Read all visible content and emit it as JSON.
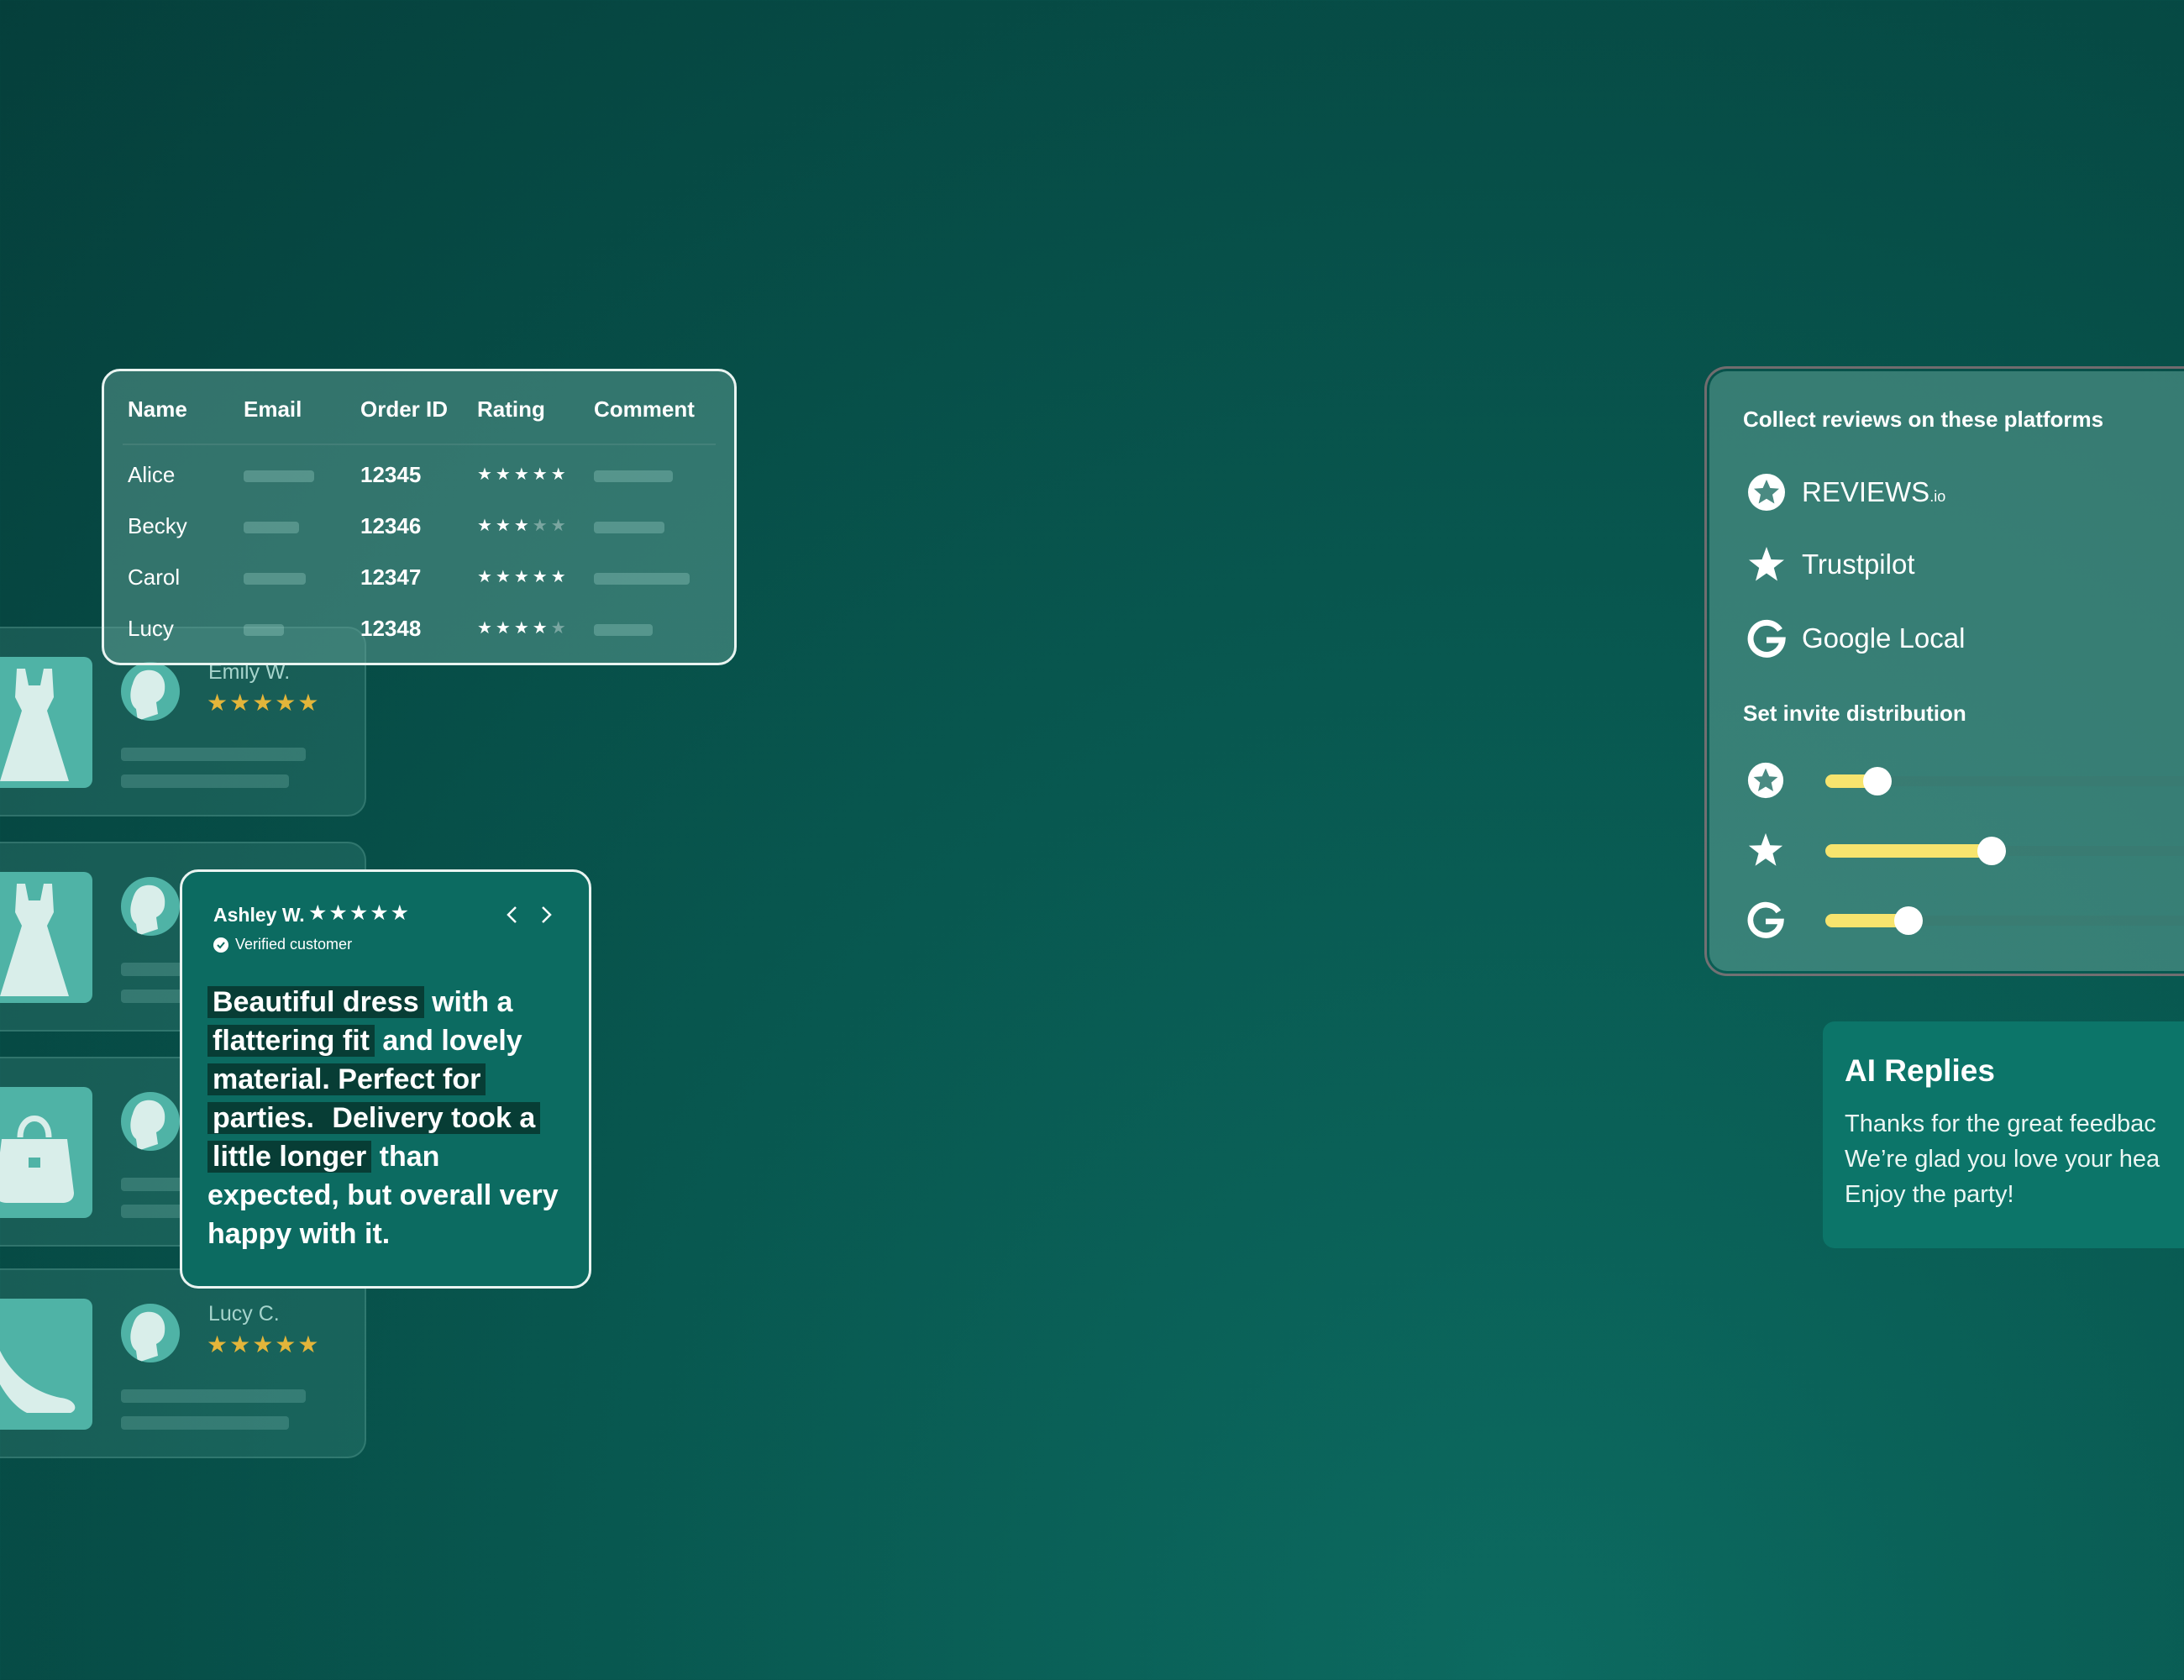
{
  "table": {
    "headers": [
      "Name",
      "Email",
      "Order ID",
      "Rating",
      "Comment"
    ],
    "rows": [
      {
        "name": "Alice",
        "order_id": "12345",
        "rating": 5
      },
      {
        "name": "Becky",
        "order_id": "12346",
        "rating": 3
      },
      {
        "name": "Carol",
        "order_id": "12347",
        "rating": 5
      },
      {
        "name": "Lucy",
        "order_id": "12348",
        "rating": 4
      }
    ]
  },
  "review_cards": [
    {
      "name": "Emily W.",
      "stars": "★★★★★",
      "product": "dress-icon"
    },
    {
      "name": "",
      "stars": "",
      "product": "dress-icon"
    },
    {
      "name": "",
      "stars": "",
      "product": "handbag-icon"
    },
    {
      "name": "Lucy C.",
      "stars": "★★★★★",
      "product": "high-heel-icon"
    }
  ],
  "featured_review": {
    "name": "Ashley W.",
    "stars": "★★★★★",
    "verified": "Verified customer",
    "segments": [
      {
        "text": "Beautiful dress",
        "hl": true
      },
      {
        "text": " with a ",
        "hl": false
      },
      {
        "text": "flattering fit",
        "hl": true
      },
      {
        "text": " and lovely ",
        "hl": false
      },
      {
        "text": "material. Perfect for",
        "hl": true
      },
      {
        "text": " ",
        "hl": false
      },
      {
        "text": "parties.",
        "hl": true
      },
      {
        "text": " Delivery took a ",
        "hl": true
      },
      {
        "text": "little longer",
        "hl": true
      },
      {
        "text": " than expected, but overall very happy with it.",
        "hl": false
      }
    ]
  },
  "platforms": {
    "title": "Collect reviews on these platforms",
    "items": [
      {
        "label": "REVIEWS",
        "suffix": ".io",
        "icon": "reviews-io-icon"
      },
      {
        "label": "Trustpilot",
        "suffix": "",
        "icon": "trustpilot-star-icon"
      },
      {
        "label": "Google Local",
        "suffix": "",
        "icon": "google-g-icon"
      }
    ],
    "distribution_title": "Set invite distribution",
    "distribution": [
      {
        "icon": "reviews-io-icon",
        "value": 0.12
      },
      {
        "icon": "trustpilot-star-icon",
        "value": 0.38
      },
      {
        "icon": "google-g-icon",
        "value": 0.19
      }
    ],
    "slider_color": "#f7e46e"
  },
  "ai_replies": {
    "title": "AI Replies",
    "lines": [
      "Thanks for the great feedbac",
      "We’re glad you love your hea",
      "Enjoy the party!"
    ]
  }
}
